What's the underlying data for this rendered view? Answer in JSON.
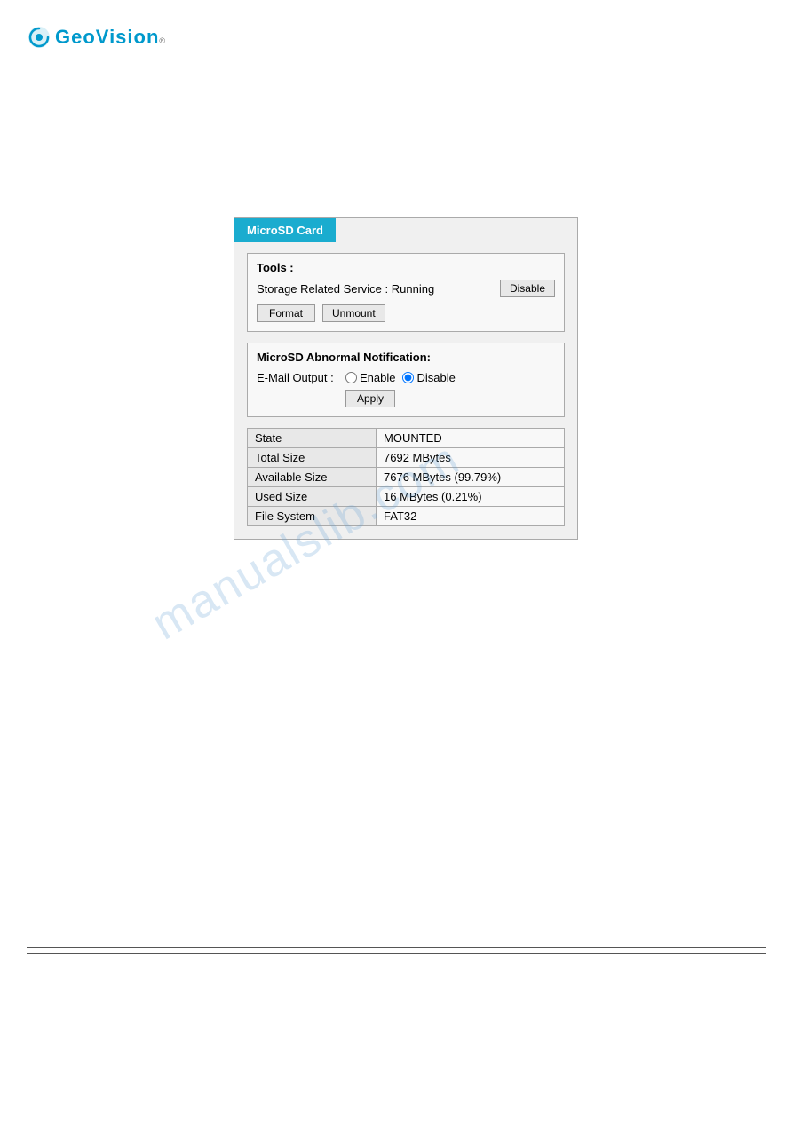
{
  "logo": {
    "text": "GeoVision",
    "reg": "®"
  },
  "card": {
    "tab_title": "MicroSD Card",
    "tools_section": {
      "label": "Tools :",
      "service_label": "Storage Related Service : Running",
      "disable_btn": "Disable",
      "format_btn": "Format",
      "unmount_btn": "Unmount"
    },
    "notification_section": {
      "title": "MicroSD Abnormal Notification:",
      "email_label": "E-Mail Output :",
      "enable_label": "Enable",
      "disable_label": "Disable",
      "apply_btn": "Apply"
    },
    "info_table": {
      "rows": [
        {
          "label": "State",
          "value": "MOUNTED"
        },
        {
          "label": "Total Size",
          "value": "7692 MBytes"
        },
        {
          "label": "Available Size",
          "value": "7676 MBytes (99.79%)"
        },
        {
          "label": "Used Size",
          "value": "16 MBytes (0.21%)"
        },
        {
          "label": "File System",
          "value": "FAT32"
        }
      ]
    }
  },
  "watermark": {
    "text": "manualslib.com"
  }
}
